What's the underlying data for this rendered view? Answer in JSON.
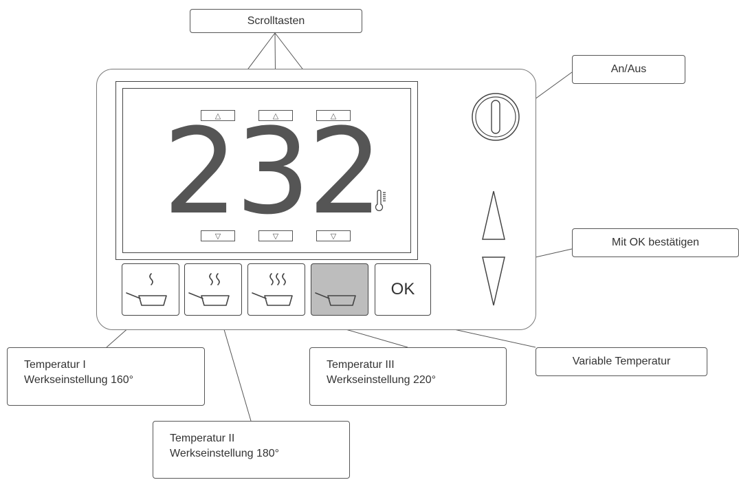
{
  "display": {
    "temperature": "232"
  },
  "ok_label": "OK",
  "callouts": {
    "scroll_keys": "Scrolltasten",
    "power": "An/Aus",
    "confirm": "Mit OK bestätigen",
    "variable": "Variable Temperatur",
    "temp1": {
      "line1": "Temperatur I",
      "line2": "Werkseinstellung 160°"
    },
    "temp2": {
      "line1": "Temperatur II",
      "line2": "Werkseinstellung 180°"
    },
    "temp3": {
      "line1": "Temperatur III",
      "line2": "Werkseinstellung 220°"
    }
  },
  "modes": [
    {
      "name": "temperature-1",
      "waves": 1,
      "active": false
    },
    {
      "name": "temperature-2",
      "waves": 2,
      "active": false
    },
    {
      "name": "temperature-3",
      "waves": 3,
      "active": false
    },
    {
      "name": "variable-temperature",
      "waves": 0,
      "active": true
    }
  ],
  "icons": [
    "thermometer-icon",
    "power-icon",
    "arrow-up-icon",
    "arrow-down-icon",
    "pan-icon",
    "steam-icon"
  ]
}
